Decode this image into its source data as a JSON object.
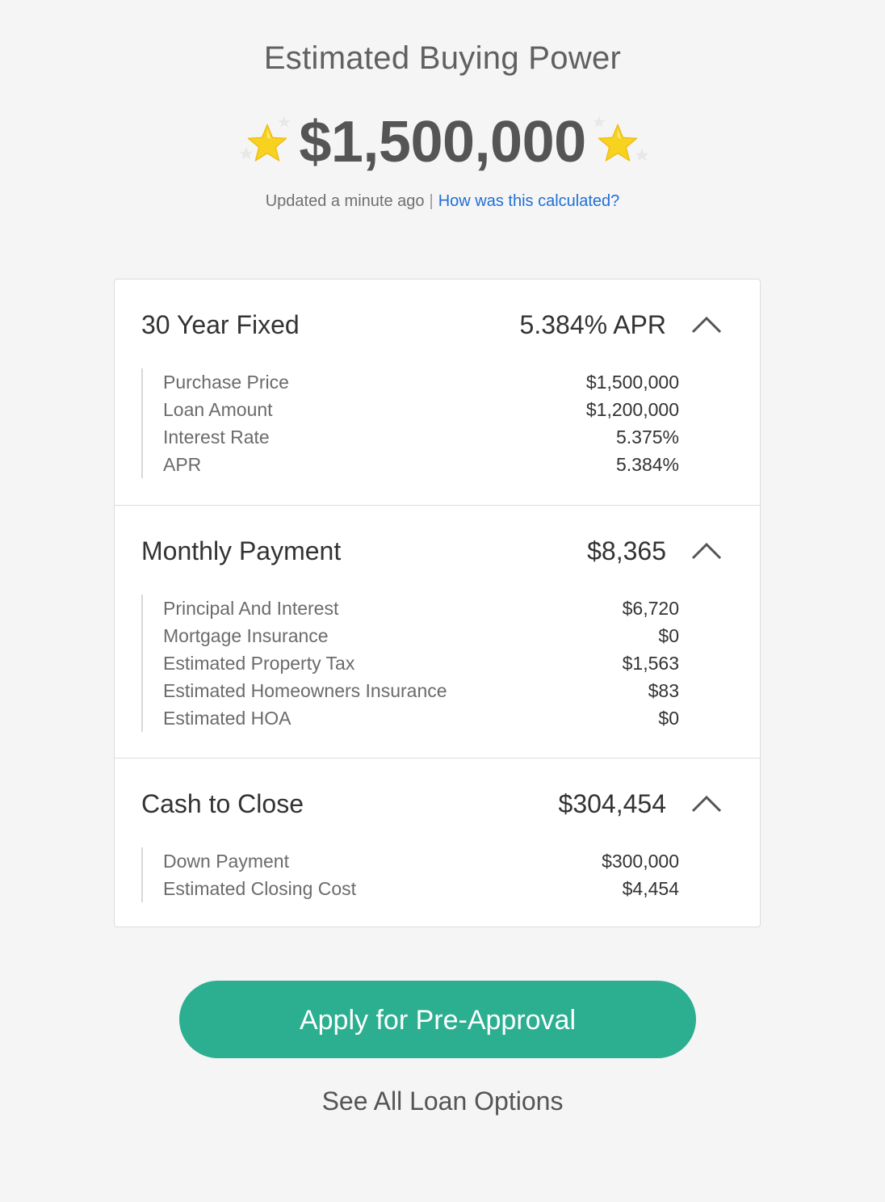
{
  "header": {
    "title": "Estimated Buying Power",
    "amount": "$1,500,000",
    "updated_text": "Updated a minute ago",
    "separator": "|",
    "calc_link": "How was this calculated?"
  },
  "sections": [
    {
      "title": "30 Year Fixed",
      "value": "5.384% APR",
      "rows": [
        {
          "label": "Purchase Price",
          "value": "$1,500,000"
        },
        {
          "label": "Loan Amount",
          "value": "$1,200,000"
        },
        {
          "label": "Interest Rate",
          "value": "5.375%"
        },
        {
          "label": "APR",
          "value": "5.384%"
        }
      ]
    },
    {
      "title": "Monthly Payment",
      "value": "$8,365",
      "rows": [
        {
          "label": "Principal And Interest",
          "value": "$6,720"
        },
        {
          "label": "Mortgage Insurance",
          "value": "$0"
        },
        {
          "label": "Estimated Property Tax",
          "value": "$1,563"
        },
        {
          "label": "Estimated Homeowners Insurance",
          "value": "$83"
        },
        {
          "label": "Estimated HOA",
          "value": "$0"
        }
      ]
    },
    {
      "title": "Cash to Close",
      "value": "$304,454",
      "rows": [
        {
          "label": "Down Payment",
          "value": "$300,000"
        },
        {
          "label": "Estimated Closing Cost",
          "value": "$4,454"
        }
      ]
    }
  ],
  "actions": {
    "apply_label": "Apply for Pre-Approval",
    "see_all_label": "See All Loan Options"
  },
  "colors": {
    "accent": "#2baf90",
    "link": "#1f6fd6",
    "star": "#f7d21e"
  },
  "icons": [
    "star-icon",
    "chevron-up-icon"
  ]
}
